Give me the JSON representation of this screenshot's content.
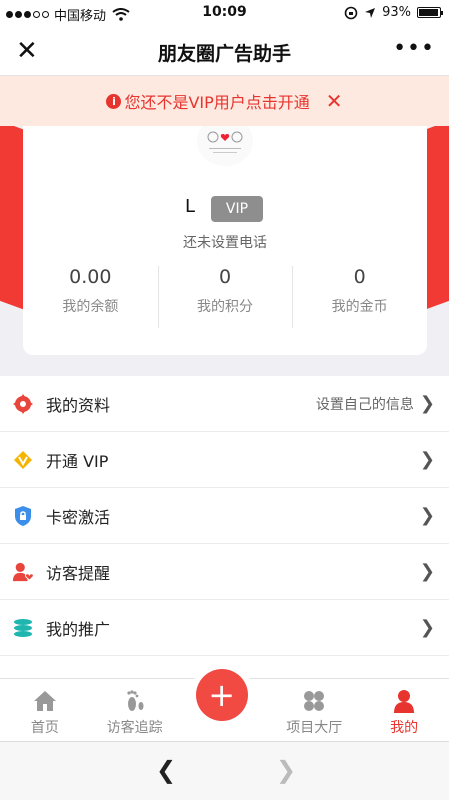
{
  "status": {
    "carrier": "中国移动",
    "time": "10:09",
    "battery": "93%"
  },
  "titlebar": {
    "title": "朋友圈广告助手"
  },
  "notice": {
    "text": "您还不是VIP用户点击开通"
  },
  "profile": {
    "name": "L",
    "badge": "VIP",
    "phone": "还未设置电话",
    "stats": [
      {
        "value": "0.00",
        "label": "我的余额"
      },
      {
        "value": "0",
        "label": "我的积分"
      },
      {
        "value": "0",
        "label": "我的金币"
      }
    ]
  },
  "menu": [
    {
      "label": "我的资料",
      "hint": "设置自己的信息",
      "icon": "gear-icon",
      "color": "#e8453c"
    },
    {
      "label": "开通 VIP",
      "hint": "",
      "icon": "vip-icon",
      "color": "#f5b400"
    },
    {
      "label": "卡密激活",
      "hint": "",
      "icon": "shield-lock-icon",
      "color": "#3b8fe8"
    },
    {
      "label": "访客提醒",
      "hint": "",
      "icon": "user-heart-icon",
      "color": "#e8453c"
    },
    {
      "label": "我的推广",
      "hint": "",
      "icon": "coins-icon",
      "color": "#1fb6b0"
    }
  ],
  "tabs": [
    {
      "label": "首页",
      "icon": "home-icon"
    },
    {
      "label": "访客追踪",
      "icon": "footprint-icon"
    },
    {
      "label": "",
      "icon": "plus-icon"
    },
    {
      "label": "项目大厅",
      "icon": "clover-icon"
    },
    {
      "label": "我的",
      "icon": "person-icon"
    }
  ],
  "colors": {
    "accent": "#e8342f",
    "notice_bg": "#fde9df"
  }
}
